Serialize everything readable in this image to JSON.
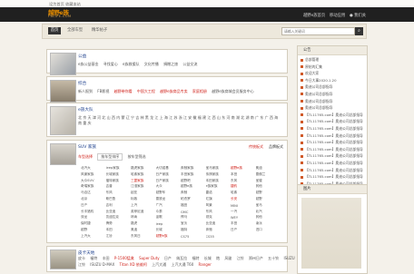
{
  "topbar": {
    "left_text": "设为首页  收藏本站"
  },
  "header": {
    "logo_title": "越野e族",
    "logo_sub": "FBLIFE.COM",
    "links": [
      "越野e族首页",
      "移动应用",
      "● 我们关"
    ]
  },
  "nav": {
    "active": "首页",
    "items": [
      "全部车型",
      "精华帖子"
    ],
    "search_placeholder": "请输入关键词",
    "search_button": "⌕"
  },
  "cards": [
    {
      "title": "公益",
      "links": [
        {
          "text": "e族公益基金",
          "style": ""
        },
        {
          "text": "寻找爱心",
          "style": ""
        },
        {
          "text": "e族救援队",
          "style": ""
        },
        {
          "text": "文化传播",
          "style": ""
        },
        {
          "text": "捐赠之旅",
          "style": ""
        },
        {
          "text": "公益交流",
          "style": ""
        }
      ]
    },
    {
      "title": "综合",
      "links": [
        {
          "text": "新人报到",
          "style": ""
        },
        {
          "text": "FB影视",
          "style": ""
        },
        {
          "text": "越野带你看",
          "style": "red"
        },
        {
          "text": "中国大工程",
          "style": "hot"
        },
        {
          "text": "越野e族商品专卖",
          "style": "hot"
        },
        {
          "text": "家庭相册",
          "style": "hot"
        },
        {
          "text": "越野e族商城会员服务中心",
          "style": ""
        }
      ]
    },
    {
      "title": "e族大队",
      "links": [
        {
          "text": "北 京 天 津 河 北 山 西 内 蒙 辽 宁 吉 林 黑 龙 江 上 海 江 苏 浙 江 安 徽 福 建 江 西 山 东 河 南 湖 北 湖 南 广 东 广 西 海 南 重 庆",
          "style": ""
        }
      ]
    },
    {
      "title": "SUV 家族",
      "subtitle_link": "传统板式",
      "subtitle_link2": "品牌板式",
      "tabs": [
        "车型选择",
        "按车型排序",
        "按车型筛选"
      ],
      "grid": [
        [
          "北汽大",
          "Jeep家族",
          "路虎家族",
          "大切诺基",
          "奔驰家族",
          "宝马家族",
          "越野e族",
          "奥迪"
        ],
        [
          "风景家族",
          "长城家族",
          "哈弗家族",
          "日产家族",
          "丰田家族",
          "传祺家族",
          "本田",
          "雪佛兰"
        ],
        [
          "大众SUV",
          "福特家族",
          "三菱家族",
          "日产家族",
          "越野吧",
          "本田家族",
          "东风",
          "宝骏"
        ],
        [
          "奇瑞家族",
          "吉普",
          "江淮家族",
          "大众",
          "越野e族",
          "e族家族",
          "捷豹",
          "其他"
        ],
        [
          "马自达",
          "东风",
          "起亚",
          "越野车",
          "奔驰",
          "雷诺",
          "哈弗",
          "越野"
        ],
        [
          "北京",
          "斯巴鲁",
          "标致",
          "雪铁龙",
          "帕杰罗",
          "红旗",
          "长安",
          "越野"
        ],
        [
          "日产",
          "吉利",
          "上汽",
          "广汽",
          "福田",
          "风景",
          "MINI",
          "宝马"
        ],
        [
          "长丰猎豹",
          "比亚迪",
          "英菲尼迪",
          "众泰",
          "GMC",
          "东风",
          "一汽",
          "北汽"
        ],
        [
          "双龙",
          "凯迪拉克",
          "林肯",
          "讴歌",
          "悍马",
          "领克",
          "WEY",
          "其他"
        ],
        [
          "保时捷",
          "腾势",
          "路虎",
          "Jeep",
          "宝沃",
          "比亚迪",
          "丰田",
          "凌派"
        ],
        [
          "越野",
          "本田",
          "奥迪",
          "长城",
          "福特",
          "奔驰",
          "日产",
          "进口"
        ],
        [
          "上汽大",
          "江铃",
          "东风日",
          "越野e族",
          "CS75",
          "CS35",
          "",
          ""
        ]
      ]
    },
    {
      "title": "皮卡天地",
      "links": [
        {
          "text": "皮卡",
          "style": ""
        },
        {
          "text": "福特",
          "style": ""
        },
        {
          "text": "丰田",
          "style": ""
        },
        {
          "text": "P-1500猛禽",
          "style": "hot"
        },
        {
          "text": "Super Duty",
          "style": "hot"
        },
        {
          "text": "日产",
          "style": ""
        },
        {
          "text": "纳瓦拉",
          "style": ""
        },
        {
          "text": "福特",
          "style": ""
        },
        {
          "text": "长城",
          "style": ""
        },
        {
          "text": "炮",
          "style": ""
        },
        {
          "text": "风骏",
          "style": ""
        },
        {
          "text": "江铃",
          "style": ""
        },
        {
          "text": "郑州日产",
          "style": ""
        },
        {
          "text": "五十铃",
          "style": ""
        },
        {
          "text": "ISUZU",
          "style": ""
        }
      ],
      "links2": [
        {
          "text": "江铃",
          "style": ""
        },
        {
          "text": "ISUZU D-MAX",
          "style": ""
        },
        {
          "text": "Titan XD 依维柯",
          "style": "hot"
        },
        {
          "text": "上汽大通",
          "style": ""
        },
        {
          "text": "上汽大通 T60",
          "style": ""
        },
        {
          "text": "Ranger",
          "style": ""
        }
      ]
    }
  ],
  "sidebar": {
    "head": "公告",
    "items": [
      "总部管理",
      "原帖的汇集",
      "欢迎大家",
      "今日大事2020.1.20",
      "奥迪公司总部指导",
      "奥迪公司总部指导",
      "奥迪公司总部指导",
      "奥迪公司总部指导",
      "【TL11765.com】奥迪公司总部指导",
      "【TL11765.com】奥迪公司总部指导",
      "【TL11765.com】奥迪公司总部指导",
      "【TL11765.com】奥迪公司总部指导",
      "【TL11765.com】奥迪公司总部指导",
      "【TL11765.com】奥迪公司总部指导",
      "【TL11765.com】奥迪公司总部指导",
      "【TL11765.com】奥迪公司总部指导",
      "【TL11765.com】奥迪公司总部指导",
      "【TL11765.com】奥迪公司总部指导",
      "【TL11765.com】奥迪公司总部指导"
    ]
  },
  "sidebar2": {
    "head": "图片"
  }
}
